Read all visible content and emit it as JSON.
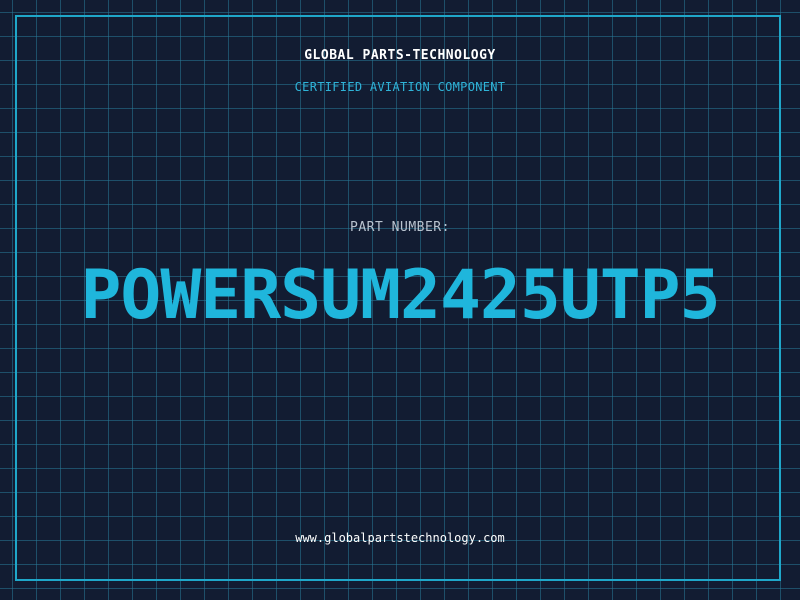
{
  "header": {
    "company": "GLOBAL PARTS-TECHNOLOGY",
    "subtitle": "CERTIFIED AVIATION COMPONENT"
  },
  "part": {
    "label": "PART NUMBER:",
    "number": "POWERSUM2425UTP5"
  },
  "footer": {
    "website": "www.globalpartstechnology.com"
  },
  "colors": {
    "background": "#121c32",
    "grid": "#287896",
    "accent": "#1fb6dc",
    "frame": "#1fa7c9"
  }
}
